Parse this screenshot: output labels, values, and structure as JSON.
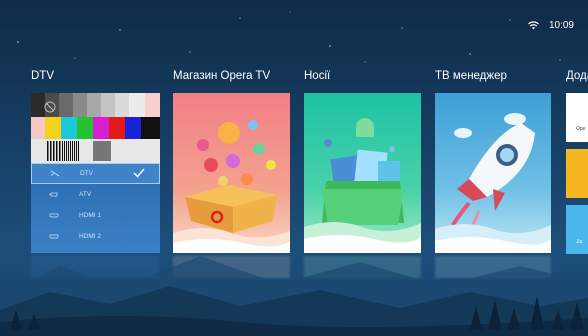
{
  "status": {
    "time": "10:09",
    "wifi_icon": "wifi-icon"
  },
  "sections": {
    "dtv": "DTV",
    "opera": "Магазин Opera TV",
    "media": "Носії",
    "tv_manager": "ТВ менеджер",
    "more": "Додат"
  },
  "sources": [
    {
      "label": "DTV",
      "icon": "antenna-icon",
      "selected": true
    },
    {
      "label": "ATV",
      "icon": "antenna-plug-icon",
      "selected": false
    },
    {
      "label": "HDMI 1",
      "icon": "hdmi-icon",
      "selected": false
    },
    {
      "label": "HDMI 2",
      "icon": "hdmi-icon",
      "selected": false
    }
  ],
  "extra_tiles": {
    "first": "Ope",
    "third": "Jia"
  },
  "colors": {
    "opera_card": "#f17f86",
    "media_card": "#1ec2a4",
    "tv_manager_card": "#3d9fd6",
    "extra_yellow": "#f5b820",
    "extra_blue": "#49b7ec",
    "selection": "#9fd0ff"
  }
}
